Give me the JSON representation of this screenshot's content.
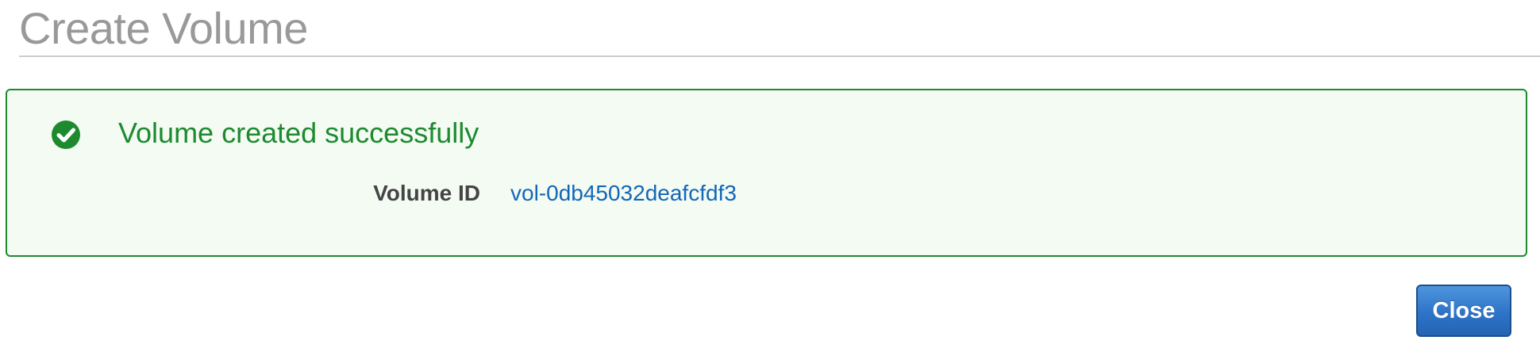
{
  "page": {
    "title": "Create Volume"
  },
  "alert": {
    "icon": "check-circle-icon",
    "title": "Volume created successfully",
    "details": {
      "label": "Volume ID",
      "value": "vol-0db45032deafcfdf3"
    },
    "colors": {
      "success": "#1d8a2f",
      "background": "#f3fbf3",
      "link": "#1466b8"
    }
  },
  "actions": {
    "close_label": "Close",
    "primary_color": "#2d74c8"
  }
}
